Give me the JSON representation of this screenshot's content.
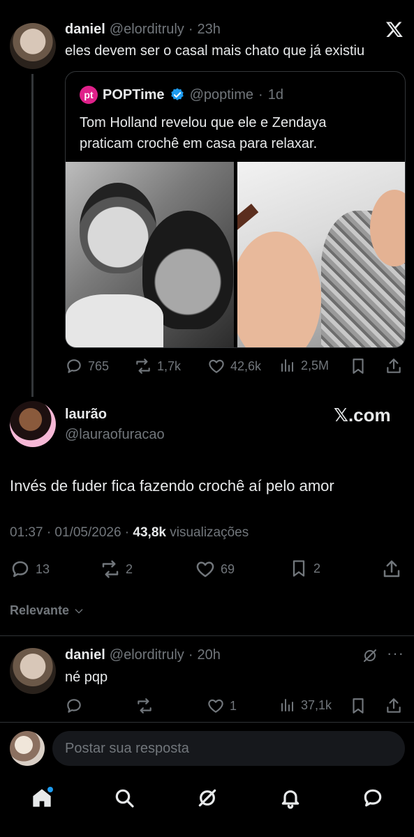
{
  "tweet1": {
    "name": "daniel",
    "handle": "@elorditruly",
    "time": "23h",
    "text": "eles devem ser o casal mais chato que já existiu",
    "quote": {
      "avatar_text": "pt",
      "name": "POPTime",
      "handle": "@poptime",
      "time": "1d",
      "text_line1": "Tom Holland revelou que ele e Zendaya",
      "text_line2": "praticam crochê em casa para relaxar."
    },
    "stats": {
      "replies": "765",
      "retweets": "1,7k",
      "likes": "42,6k",
      "views": "2,5M"
    }
  },
  "main_tweet": {
    "name": "laurão",
    "handle": "@lauraofuracao",
    "watermark": "𝕏.com",
    "text": "Invés de fuder fica fazendo crochê aí pelo amor",
    "timestamp": "01:37 · 01/05/2026 · ",
    "views_count": "43,8k",
    "views_label": " visualizações",
    "stats": {
      "replies": "13",
      "retweets": "2",
      "likes": "69",
      "bookmarks": "2"
    }
  },
  "sort_label": "Relevante",
  "reply": {
    "name": "daniel",
    "handle": "@elorditruly",
    "time": "20h",
    "text": "né pqp",
    "stats": {
      "likes": "1",
      "views": "37,1k"
    }
  },
  "compose": {
    "placeholder": "Postar sua resposta"
  },
  "colors": {
    "background": "#000000",
    "muted": "#71767b",
    "text": "#e7e9ea",
    "verified": "#1d9bf0",
    "poptime": "#e0218a"
  }
}
